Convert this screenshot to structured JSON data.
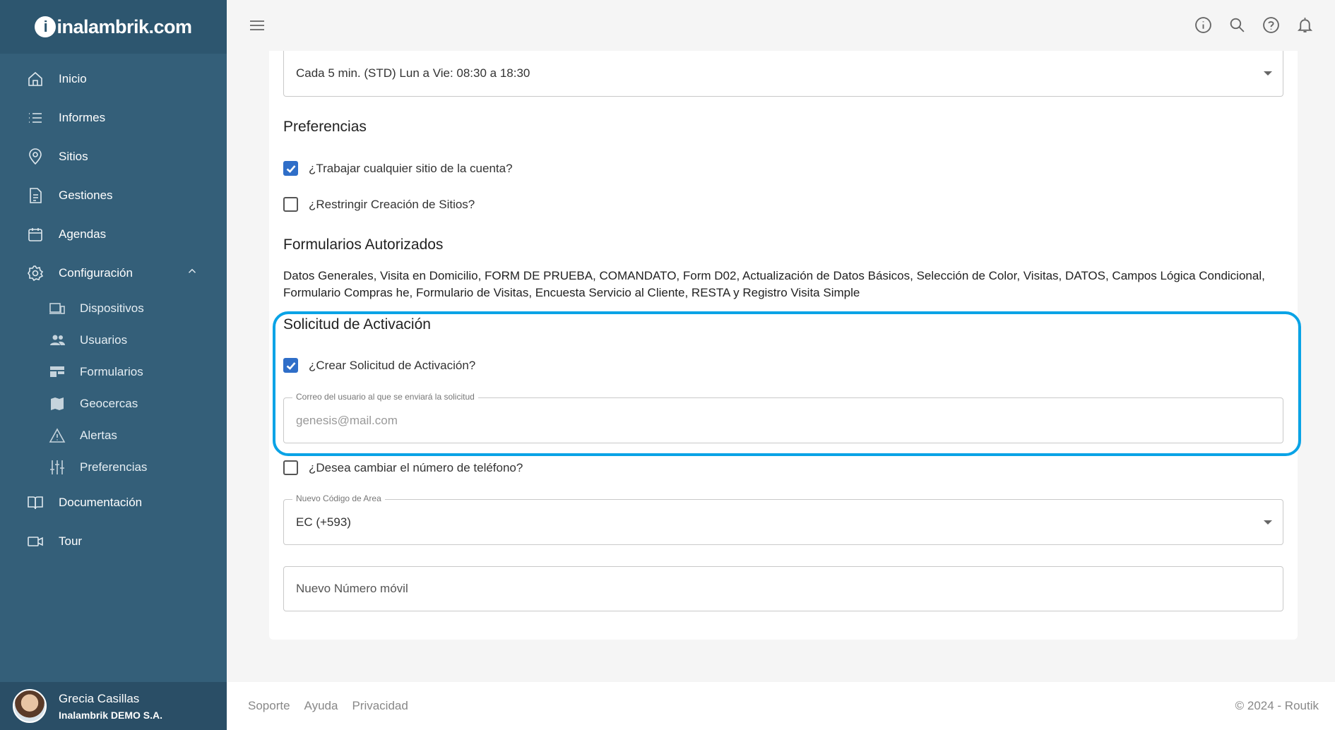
{
  "brand": {
    "logo_text": "inalambrik.com"
  },
  "sidebar": {
    "items": [
      {
        "label": "Inicio",
        "icon": "home-icon"
      },
      {
        "label": "Informes",
        "icon": "list-icon"
      },
      {
        "label": "Sitios",
        "icon": "location-pin-icon"
      },
      {
        "label": "Gestiones",
        "icon": "document-icon"
      },
      {
        "label": "Agendas",
        "icon": "calendar-icon"
      },
      {
        "label": "Configuración",
        "icon": "gear-icon",
        "expanded": true
      }
    ],
    "sub_items": [
      {
        "label": "Dispositivos",
        "icon": "devices-icon"
      },
      {
        "label": "Usuarios",
        "icon": "users-icon"
      },
      {
        "label": "Formularios",
        "icon": "forms-icon"
      },
      {
        "label": "Geocercas",
        "icon": "map-icon"
      },
      {
        "label": "Alertas",
        "icon": "warning-icon"
      },
      {
        "label": "Preferencias",
        "icon": "sliders-icon"
      }
    ],
    "bottom_items": [
      {
        "label": "Documentación",
        "icon": "book-icon"
      },
      {
        "label": "Tour",
        "icon": "video-icon"
      }
    ]
  },
  "user": {
    "name": "Grecia Casillas",
    "company": "Inalambrik DEMO S.A."
  },
  "form": {
    "schedule_value": "Cada 5 min. (STD) Lun a Vie: 08:30 a 18:30",
    "preferences_title": "Preferencias",
    "pref_any_site_label": "¿Trabajar cualquier sitio de la cuenta?",
    "pref_any_site_checked": true,
    "pref_restrict_sites_label": "¿Restringir Creación de Sitios?",
    "pref_restrict_sites_checked": false,
    "authorized_forms_title": "Formularios Autorizados",
    "authorized_forms_line1": "Datos Generales, Visita en Domicilio, FORM DE PRUEBA, COMANDATO, Form D02, Actualización de Datos Básicos, Selección de Color, Visitas, DATOS, Campos Lógica Condicional,",
    "authorized_forms_line2": "Formulario Compras he, Formulario de Visitas, Encuesta Servicio al Cliente, RESTA y Registro Visita Simple",
    "activation_title": "Solicitud de Activación",
    "activation_create_label": "¿Crear Solicitud de Activación?",
    "activation_create_checked": true,
    "activation_email_legend": "Correo del usuario al que se enviará la solicitud",
    "activation_email_placeholder": "genesis@mail.com",
    "change_phone_label": "¿Desea cambiar el número de teléfono?",
    "change_phone_checked": false,
    "area_code_legend": "Nuevo Código de Area",
    "area_code_value": "EC (+593)",
    "new_mobile_placeholder": "Nuevo Número móvil"
  },
  "topbar": {
    "icons": [
      "info-icon",
      "search-icon",
      "help-icon",
      "bell-icon"
    ]
  },
  "footer": {
    "links": [
      "Soporte",
      "Ayuda",
      "Privacidad"
    ],
    "copyright": "© 2024 - Routik"
  },
  "colors": {
    "sidebar": "#345f79",
    "accent": "#2f6ec8",
    "highlight": "#0aa3e6"
  }
}
